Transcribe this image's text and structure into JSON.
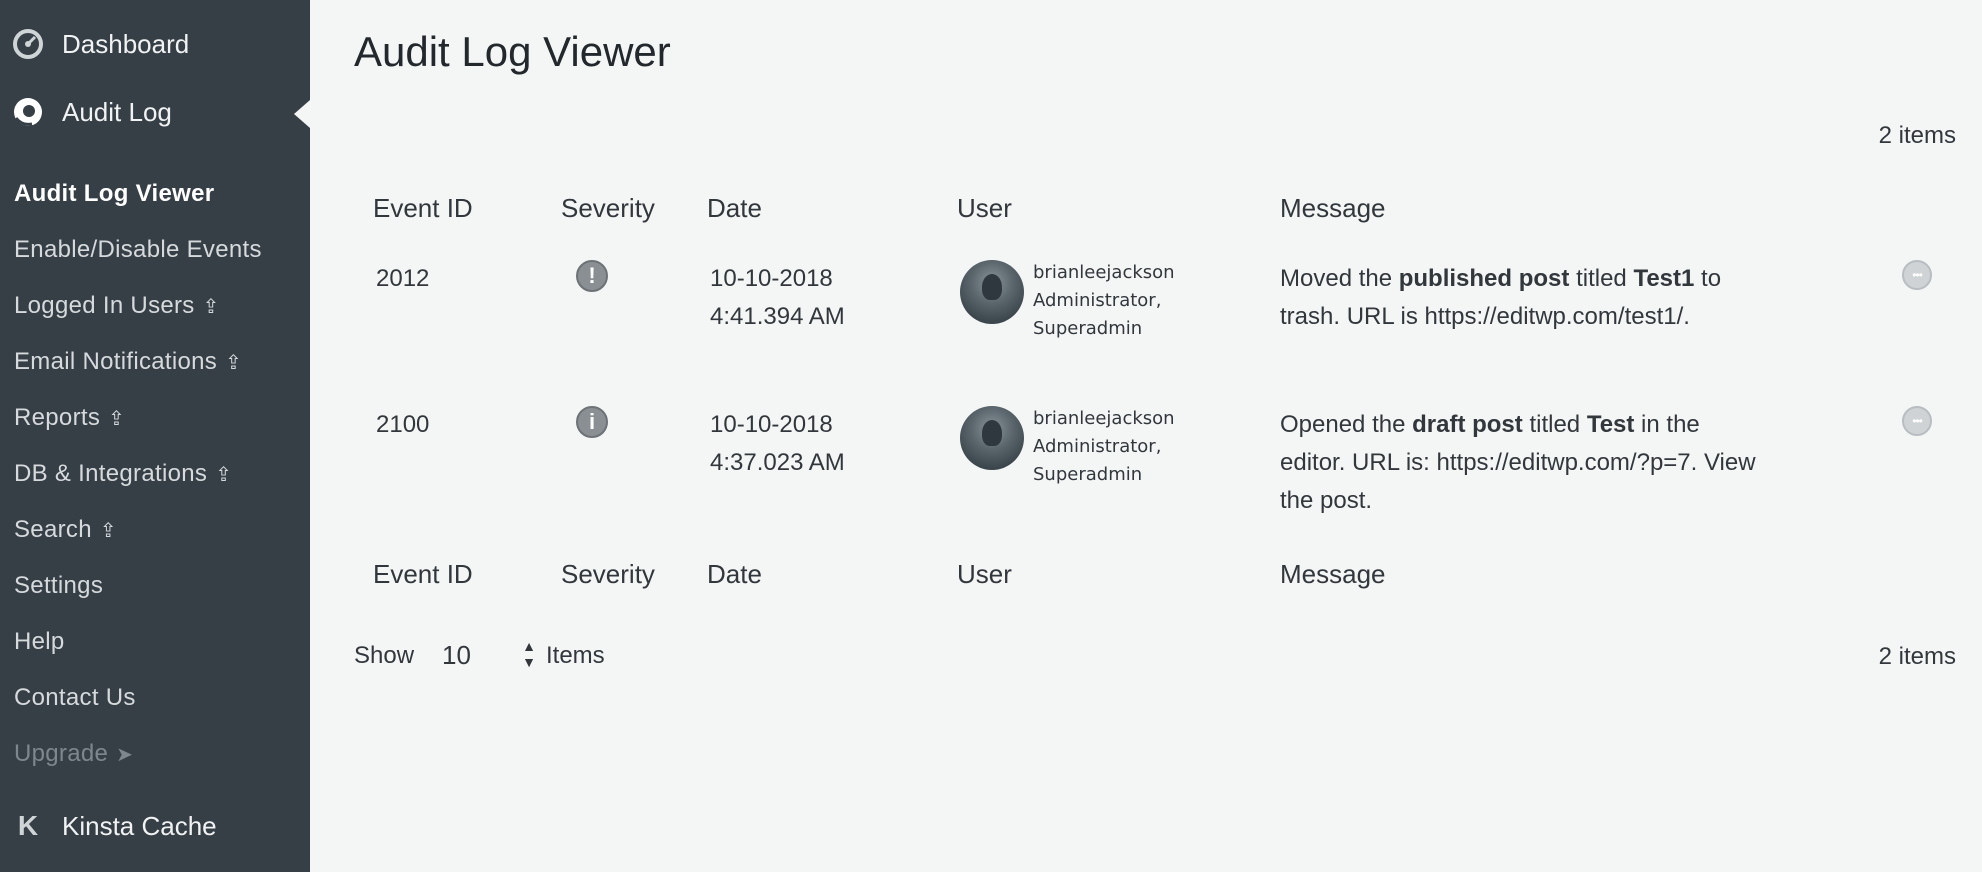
{
  "sidebar": {
    "dashboard": {
      "label": "Dashboard",
      "icon": "dashboard-gauge-icon"
    },
    "audit_log": {
      "label": "Audit Log",
      "icon": "audit-log-icon"
    },
    "submenu": [
      {
        "label": "Audit Log Viewer",
        "current": true,
        "upgrade": false
      },
      {
        "label": "Enable/Disable Events",
        "current": false,
        "upgrade": false
      },
      {
        "label": "Logged In Users",
        "current": false,
        "upgrade": true
      },
      {
        "label": "Email Notifications",
        "current": false,
        "upgrade": true
      },
      {
        "label": "Reports",
        "current": false,
        "upgrade": true
      },
      {
        "label": "DB & Integrations",
        "current": false,
        "upgrade": true
      },
      {
        "label": "Search",
        "current": false,
        "upgrade": true
      },
      {
        "label": "Settings",
        "current": false,
        "upgrade": false
      },
      {
        "label": "Help",
        "current": false,
        "upgrade": false
      },
      {
        "label": "Contact Us",
        "current": false,
        "upgrade": false
      },
      {
        "label": "Upgrade",
        "current": false,
        "upgrade": false,
        "arrow": "➤"
      }
    ],
    "upgrade_icon": "⇪",
    "kinsta": {
      "label": "Kinsta Cache",
      "icon": "kinsta-k-icon",
      "glyph": "K"
    }
  },
  "main": {
    "title": "Audit Log Viewer",
    "item_count": "2 items",
    "columns": {
      "event_id": "Event ID",
      "severity": "Severity",
      "date": "Date",
      "user": "User",
      "message": "Message"
    },
    "rows": [
      {
        "event_id": "2012",
        "severity_glyph": "!",
        "date_line1": "10-10-2018",
        "date_line2": "4:41.394 AM",
        "user_name": "brianleejackson",
        "user_role1": "Administrator,",
        "user_role2": "Superadmin",
        "msg_parts": [
          "Moved the ",
          "published post",
          " titled ",
          "Test1",
          " to trash. URL is https://editwp.com/test1/."
        ]
      },
      {
        "event_id": "2100",
        "severity_glyph": "i",
        "date_line1": "10-10-2018",
        "date_line2": "4:37.023 AM",
        "user_name": "brianleejackson",
        "user_role1": "Administrator,",
        "user_role2": "Superadmin",
        "msg_parts": [
          "Opened the ",
          "draft post",
          " titled ",
          "Test",
          " in the editor. URL is: https://editwp.com/?p=7. View the post."
        ]
      }
    ],
    "more_glyph": "•••",
    "pagination": {
      "show_label": "Show",
      "per_page": "10",
      "items_label": "Items"
    }
  }
}
